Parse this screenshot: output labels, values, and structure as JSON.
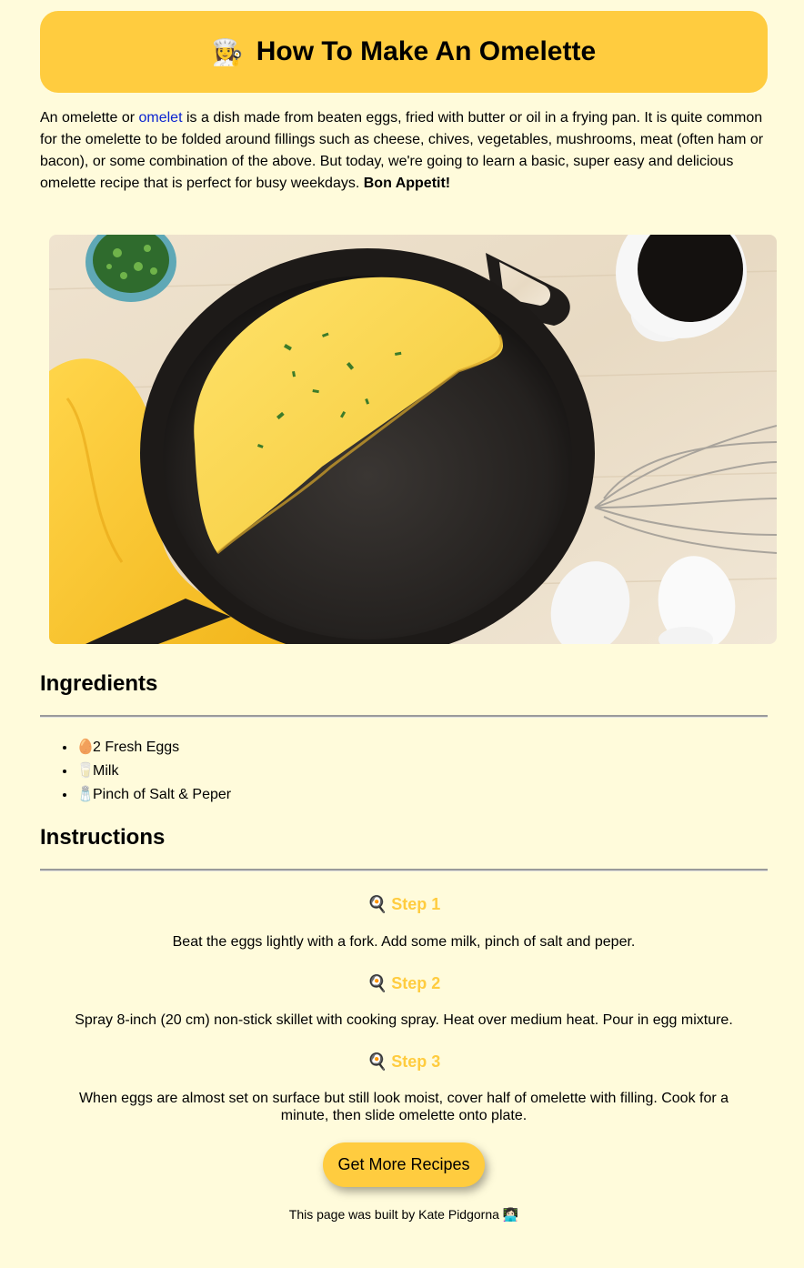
{
  "header": {
    "icon": "chef-icon",
    "title": "How To Make An Omelette"
  },
  "intro": {
    "text_before_link": "An omelette or ",
    "link_text": "omelet",
    "text_after_link": " is a dish made from beaten eggs, fried with butter or oil in a frying pan. It is quite common for the omelette to be folded around fillings such as cheese, chives, vegetables, mushrooms, meat (often ham or bacon), or some combination of the above. But today, we're going to learn a basic, super easy and delicious omelette recipe that is perfect for busy weekdays. ",
    "bold_text": "Bon Appetit!"
  },
  "ingredients": {
    "heading": "Ingredients",
    "items": [
      {
        "icon": "egg-icon",
        "label": "2 Fresh Eggs"
      },
      {
        "icon": "milk-glass-icon",
        "label": "Milk"
      },
      {
        "icon": "salt-shaker-icon",
        "label": "Pinch of Salt & Peper"
      }
    ]
  },
  "instructions": {
    "heading": "Instructions",
    "steps": [
      {
        "icon": "frying-pan-icon",
        "title": "Step 1",
        "text": "Beat the eggs lightly with a fork. Add some milk, pinch of salt and peper."
      },
      {
        "icon": "frying-pan-icon",
        "title": "Step 2",
        "text": "Spray 8-inch (20 cm) non-stick skillet with cooking spray. Heat over medium heat. Pour in egg mixture."
      },
      {
        "icon": "frying-pan-icon",
        "title": "Step 3",
        "text": "When eggs are almost set on surface but still look moist, cover half of omelette with filling. Cook for a minute, then slide omelette onto plate."
      }
    ]
  },
  "button": {
    "label": "Get More Recipes"
  },
  "footer": {
    "text": "This page was built by Kate Pidgorna",
    "icon": "woman-technologist-icon"
  },
  "colors": {
    "background": "#fffbdb",
    "accent": "#ffcc3f",
    "link": "#0b24d1"
  }
}
